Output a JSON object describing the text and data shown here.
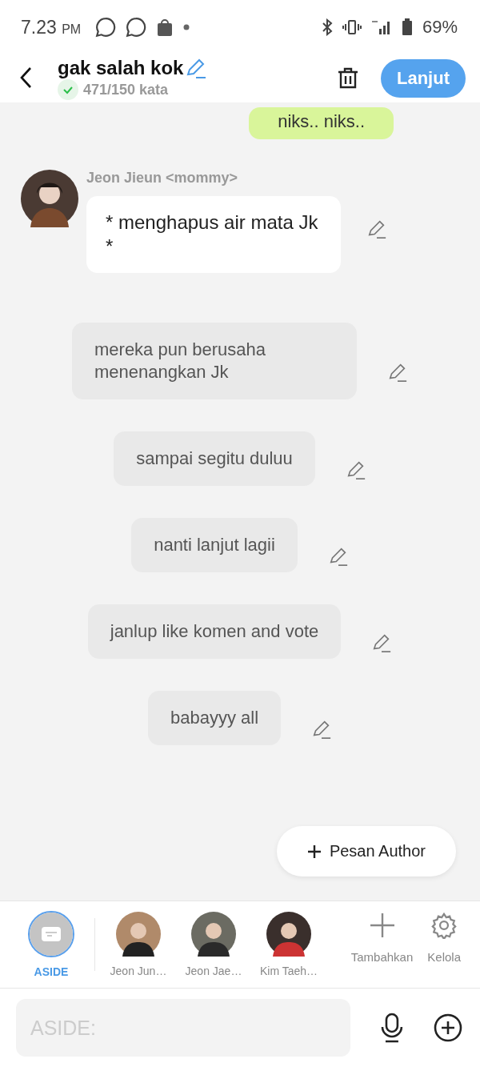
{
  "status_bar": {
    "time": "7.23",
    "ampm": "PM",
    "battery": "69%"
  },
  "header": {
    "title": "gak salah kok",
    "word_count": "471/150 kata",
    "word_goal_met": true,
    "next_button": "Lanjut"
  },
  "messages": [
    {
      "kind": "outgoing",
      "text": "niks.. niks.."
    },
    {
      "kind": "character",
      "name": "Jeon Jieun <mommy>",
      "text": "* menghapus air mata Jk *"
    },
    {
      "kind": "narration",
      "text": "mereka pun berusaha menenangkan Jk"
    },
    {
      "kind": "narration",
      "text": "sampai segitu duluu"
    },
    {
      "kind": "narration",
      "text": "nanti lanjut lagii"
    },
    {
      "kind": "narration",
      "text": "janlup like komen and vote"
    },
    {
      "kind": "narration",
      "text": "babayyy all"
    }
  ],
  "author_button": {
    "label": "Pesan Author"
  },
  "characters": [
    {
      "kind": "aside",
      "name": "ASIDE",
      "selected": true
    },
    {
      "kind": "person",
      "name": "Jeon Jun…",
      "selected": false
    },
    {
      "kind": "person",
      "name": "Jeon Jae…",
      "selected": false
    },
    {
      "kind": "person",
      "name": "Kim Taeh…",
      "selected": false
    }
  ],
  "actions": [
    {
      "kind": "add",
      "label": "Tambahkan"
    },
    {
      "kind": "manage",
      "label": "Kelola"
    }
  ],
  "composer": {
    "placeholder": "ASIDE:"
  }
}
